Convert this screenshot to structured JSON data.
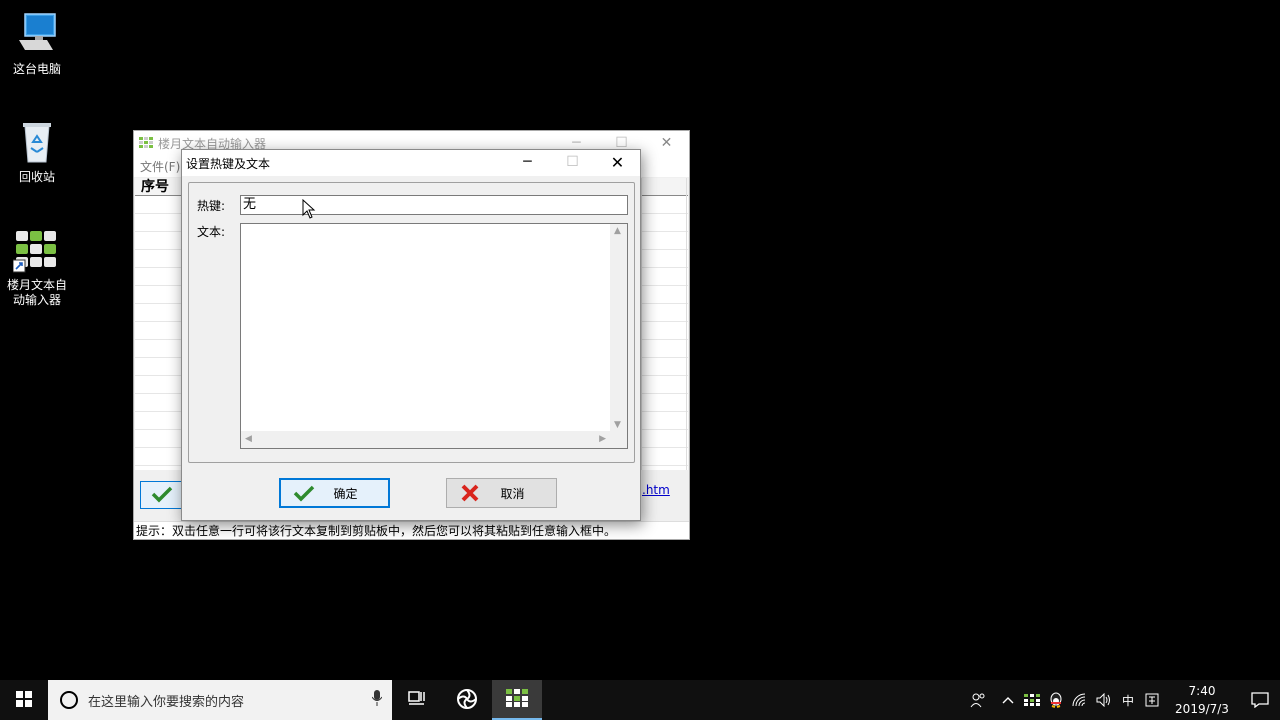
{
  "desktop": {
    "icons": [
      {
        "label": "这台电脑"
      },
      {
        "label": "回收站"
      },
      {
        "label_line1": "楼月文本自",
        "label_line2": "动输入器"
      }
    ]
  },
  "main_window": {
    "title": "楼月文本自动输入器",
    "menu_file": "文件(F)",
    "column_header": "序号",
    "link_text": ".htm",
    "status_text": "提示：双击任意一行可将该行文本复制到剪贴板中，然后您可以将其粘贴到任意输入框中。"
  },
  "dialog": {
    "title": "设置热键及文本",
    "hotkey_label": "热键:",
    "hotkey_value": "无",
    "text_label": "文本:",
    "text_value": "",
    "ok_label": "确定",
    "cancel_label": "取消"
  },
  "taskbar": {
    "search_placeholder": "在这里输入你要搜索的内容",
    "ime_label": "中",
    "time": "7:40",
    "date": "2019/7/3"
  },
  "colors": {
    "accent": "#0078d7",
    "ok_check": "#2e8b2e",
    "cancel_x": "#d9251d",
    "desktop_bg": "#000000"
  }
}
